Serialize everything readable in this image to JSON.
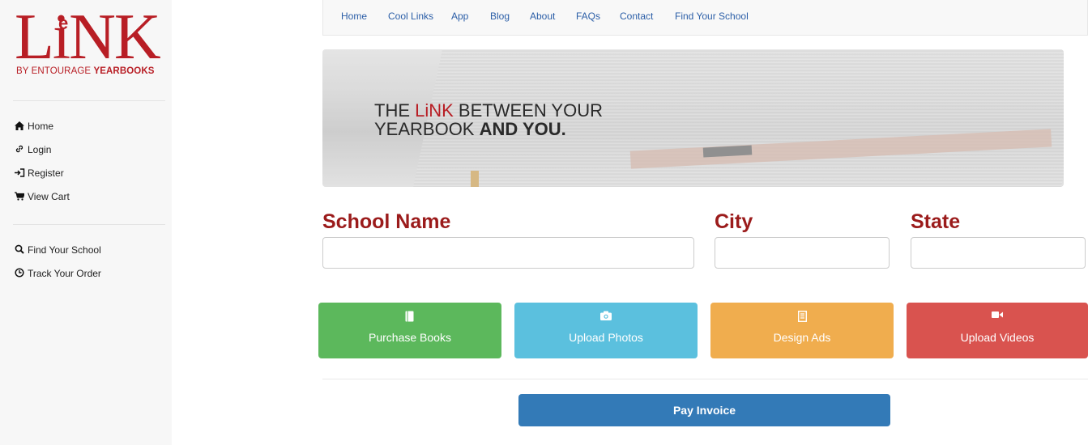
{
  "logo": {
    "word": "LiNK",
    "e_mark": "e",
    "sub_plain": "BY ENTOURAGE",
    "sub_bold": "YEARBOOKS"
  },
  "sidebar": {
    "main_items": [
      {
        "label": "Home",
        "icon": "home-icon"
      },
      {
        "label": "Login",
        "icon": "link-icon"
      },
      {
        "label": "Register",
        "icon": "sign-in-icon"
      },
      {
        "label": "View Cart",
        "icon": "cart-icon"
      }
    ],
    "secondary_items": [
      {
        "label": "Find Your School",
        "icon": "search-icon"
      },
      {
        "label": "Track Your Order",
        "icon": "clock-icon"
      }
    ]
  },
  "nav": {
    "items": [
      "Home",
      "Cool Links",
      "App",
      "Blog",
      "About",
      "FAQs",
      "Contact",
      "Find Your School"
    ]
  },
  "banner": {
    "line1_pre": "THE ",
    "line1_link": "LiNK",
    "line1_post": " BETWEEN YOUR",
    "line2_pre": "YEARBOOK ",
    "line2_bold": "AND YOU."
  },
  "search": {
    "school_label": "School Name",
    "city_label": "City",
    "state_label": "State",
    "school_value": "",
    "city_value": "",
    "state_value": ""
  },
  "actions": [
    {
      "label": "Purchase Books",
      "icon": "book-icon",
      "color": "#5cb85c"
    },
    {
      "label": "Upload Photos",
      "icon": "camera-icon",
      "color": "#5bc0de"
    },
    {
      "label": "Design Ads",
      "icon": "list-icon",
      "color": "#f0ad4e"
    },
    {
      "label": "Upload Videos",
      "icon": "video-camera-icon",
      "color": "#d9534f"
    }
  ],
  "pay_invoice": {
    "label": "Pay Invoice",
    "color": "#337ab7"
  },
  "colors": {
    "brand": "#b81e25",
    "label": "#9b1b1b",
    "nav_link": "#2b5ea7"
  }
}
